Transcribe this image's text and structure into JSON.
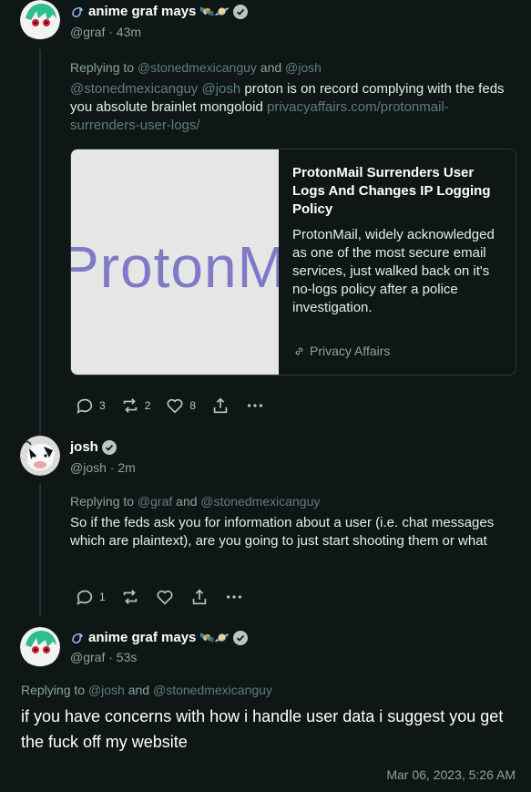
{
  "posts": [
    {
      "display_name": "anime graf mays",
      "name_prefix_icon": "bird-icon",
      "name_suffix_emoji": "🛰️🪐",
      "handle_time": "@graf · 43m",
      "replying_prefix": "Replying to",
      "replying_a": "@stonedmexicanguy",
      "replying_and": "and",
      "replying_b": "@josh",
      "mentions": "@stonedmexicanguy @josh",
      "text": "proton is on record complying with the feds you absolute brainlet mongoloid",
      "link_text": "privacyaffairs.com/protonmail-surrenders-user-logs/",
      "card": {
        "image_text": "ProtonM",
        "title": "ProtonMail Surrenders User Logs And Changes IP Logging Policy",
        "description": "ProtonMail, widely acknowledged as one of the most secure email services, just walked back on it's no-logs policy after a police investigation.",
        "source": "Privacy Affairs"
      },
      "counts": {
        "replies": "3",
        "reposts": "2",
        "likes": "8"
      }
    },
    {
      "display_name": "josh",
      "handle_time": "@josh · 2m",
      "replying_prefix": "Replying to",
      "replying_a": "@graf",
      "replying_and": "and",
      "replying_b": "@stonedmexicanguy",
      "text": "So if the feds ask you for information about a user (i.e. chat messages which are plaintext), are you going to just start shooting them or what",
      "counts": {
        "replies": "1"
      }
    },
    {
      "display_name": "anime graf mays",
      "name_suffix_emoji": "🛰️🪐",
      "handle_time": "@graf · 53s",
      "replying_prefix": "Replying to",
      "replying_a": "@josh",
      "replying_and": "and",
      "replying_b": "@stonedmexicanguy",
      "text": "if you have concerns with how i handle user data i suggest you get the fuck off my website",
      "timestamp": "Mar 06, 2023, 5:26 AM"
    }
  ],
  "colors": {
    "background": "#0e1716",
    "muted": "#8aa39d",
    "mention": "#5f7e78",
    "verified": "#b9c7c3"
  }
}
